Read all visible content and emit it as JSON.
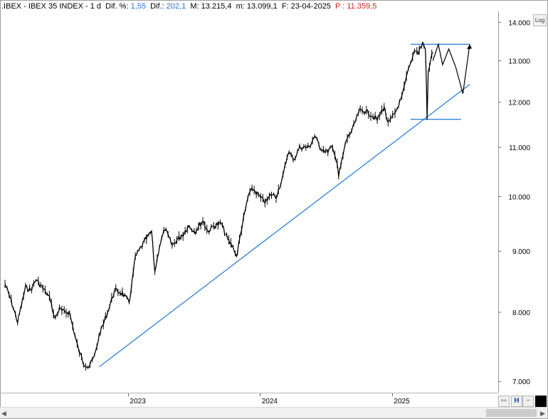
{
  "header": {
    "symbol": ".IBEX - IBEX 35 INDEX - ",
    "period": "1 d",
    "dif_pct_label": "  Dif. %: ",
    "dif_pct_value": "1,55",
    "dif_label": "  Dif.: ",
    "dif_value": "202,1",
    "max_label": "  M: ",
    "max_value": "13.215,4",
    "min_label": "  m: ",
    "min_value": "13.099,1",
    "date_label": "  F: ",
    "date_value": "23-04-2025",
    "price_label": "  P : ",
    "price_value": "11.359,5"
  },
  "log_button": "Log",
  "colors": {
    "price": "#000000",
    "trendline": "#1f78d4",
    "text_blue": "#2a6fd6",
    "text_red": "#d21f1f"
  },
  "toolbar_icons": [
    "shrink-zoom-icon",
    "cursor-mode-icon",
    "zoom-out-icon",
    "color-swatch-icon"
  ],
  "chart_data": {
    "type": "line",
    "title": "",
    "xlabel": "",
    "ylabel": "",
    "scale": "log",
    "ylim": [
      6850,
      14300
    ],
    "grid": false,
    "x_ticks": [
      "2023",
      "2024",
      "2025"
    ],
    "y_ticks": [
      "7.000",
      "8.000",
      "9.000",
      "10.000",
      "11.000",
      "12.000",
      "13.000",
      "14.000"
    ],
    "series": [
      {
        "type": "price",
        "x": [
          "2022-01-24",
          "2022-02-10",
          "2022-02-28",
          "2022-03-08",
          "2022-03-22",
          "2022-04-05",
          "2022-04-20",
          "2022-05-09",
          "2022-05-30",
          "2022-06-10",
          "2022-06-24",
          "2022-07-07",
          "2022-07-21",
          "2022-08-15",
          "2022-08-30",
          "2022-09-13",
          "2022-09-29",
          "2022-10-12",
          "2022-11-04",
          "2022-11-24",
          "2022-12-15",
          "2023-01-03",
          "2023-01-20",
          "2023-02-17",
          "2023-03-06",
          "2023-03-15",
          "2023-03-28",
          "2023-04-12",
          "2023-05-02",
          "2023-05-15",
          "2023-06-01",
          "2023-06-16",
          "2023-07-05",
          "2023-07-26",
          "2023-08-09",
          "2023-08-25",
          "2023-09-15",
          "2023-10-03",
          "2023-10-20",
          "2023-10-27",
          "2023-11-10",
          "2023-11-30",
          "2023-12-12",
          "2024-01-05",
          "2024-01-17",
          "2024-02-01",
          "2024-02-14",
          "2024-03-04",
          "2024-03-18",
          "2024-04-04",
          "2024-04-19",
          "2024-05-15",
          "2024-05-31",
          "2024-06-14",
          "2024-07-03",
          "2024-07-16",
          "2024-08-01",
          "2024-08-05",
          "2024-08-26",
          "2024-09-13",
          "2024-10-01",
          "2024-10-18",
          "2024-11-05",
          "2024-11-20",
          "2024-12-09",
          "2024-12-20",
          "2025-01-08",
          "2025-01-27",
          "2025-02-12",
          "2025-02-26",
          "2025-03-03",
          "2025-03-13",
          "2025-03-26",
          "2025-04-02",
          "2025-04-04",
          "2025-04-07",
          "2025-04-10",
          "2025-04-17",
          "2025-04-23"
        ],
        "y": [
          8450,
          8180,
          7850,
          8050,
          8400,
          8350,
          8520,
          8380,
          8200,
          7900,
          8050,
          8000,
          8000,
          7450,
          7250,
          7200,
          7350,
          7650,
          8000,
          8350,
          8300,
          8150,
          8900,
          9200,
          9350,
          8650,
          9100,
          9400,
          9100,
          9200,
          9300,
          9450,
          9350,
          9550,
          9350,
          9450,
          9500,
          9200,
          9050,
          8900,
          9400,
          10050,
          10150,
          9950,
          9900,
          10050,
          10000,
          10400,
          10900,
          10750,
          11000,
          11000,
          11250,
          11000,
          10900,
          11000,
          10700,
          10400,
          11150,
          11400,
          11800,
          11800,
          11700,
          11600,
          11900,
          11500,
          11750,
          12100,
          12700,
          13100,
          13300,
          13200,
          13450,
          13300,
          12800,
          11600,
          12700,
          13050,
          13215
        ]
      },
      {
        "type": "projection",
        "x": [
          "2025-04-23",
          "2025-05-08",
          "2025-05-20",
          "2025-06-06",
          "2025-06-25",
          "2025-07-15",
          "2025-08-03"
        ],
        "y": [
          13000,
          13420,
          12900,
          13300,
          12850,
          12200,
          13420
        ]
      }
    ],
    "annotations": [
      {
        "type": "trendline",
        "from": [
          "2022-10-12",
          7200
        ],
        "to": [
          "2025-08-03",
          12420
        ]
      },
      {
        "type": "horizontal",
        "from": "2025-02-20",
        "to": "2025-08-03",
        "y": 13420
      },
      {
        "type": "horizontal",
        "from": "2025-02-20",
        "to": "2025-07-10",
        "y": 11610
      }
    ]
  }
}
